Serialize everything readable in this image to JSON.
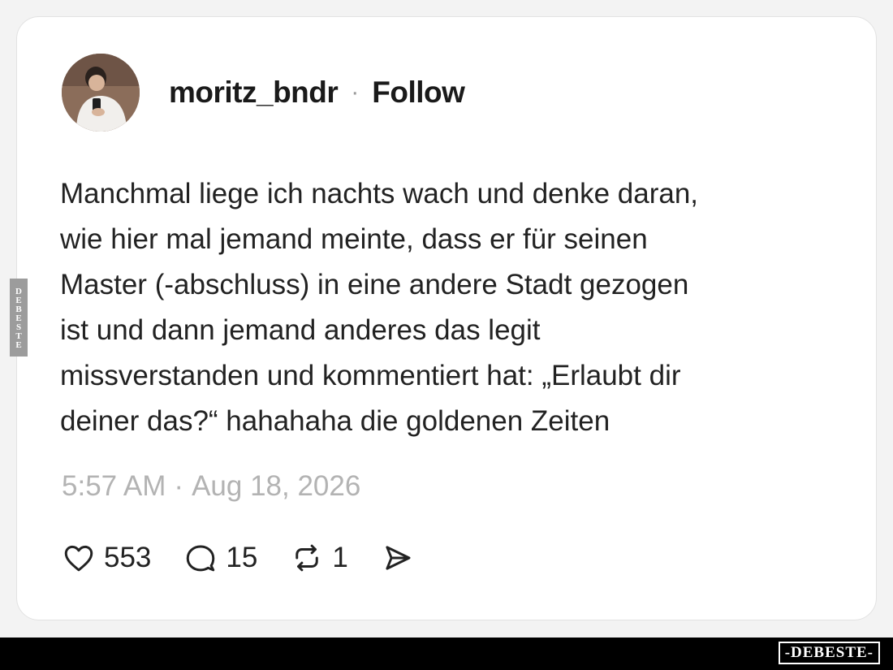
{
  "post": {
    "username": "moritz_bndr",
    "separator": "·",
    "follow_label": "Follow",
    "text": "Manchmal liege ich nachts wach und denke daran,\nwie hier mal jemand meinte, dass er für seinen\nMaster (-abschluss) in eine andere Stadt gezogen\nist und dann jemand anderes das legit\nmissverstanden und kommentiert hat: „Erlaubt dir\ndeiner das?“ hahahaha die goldenen Zeiten",
    "time": "5:57 AM",
    "date_separator": "·",
    "date": "Aug 18, 2026"
  },
  "actions": {
    "likes": {
      "icon": "heart-icon",
      "count": "553"
    },
    "comments": {
      "icon": "comment-icon",
      "count": "15"
    },
    "reposts": {
      "icon": "repost-icon",
      "count": "1"
    },
    "share": {
      "icon": "send-icon"
    }
  },
  "watermark": {
    "side": "DEBESTE",
    "bottom": "-DEBESTE-"
  }
}
